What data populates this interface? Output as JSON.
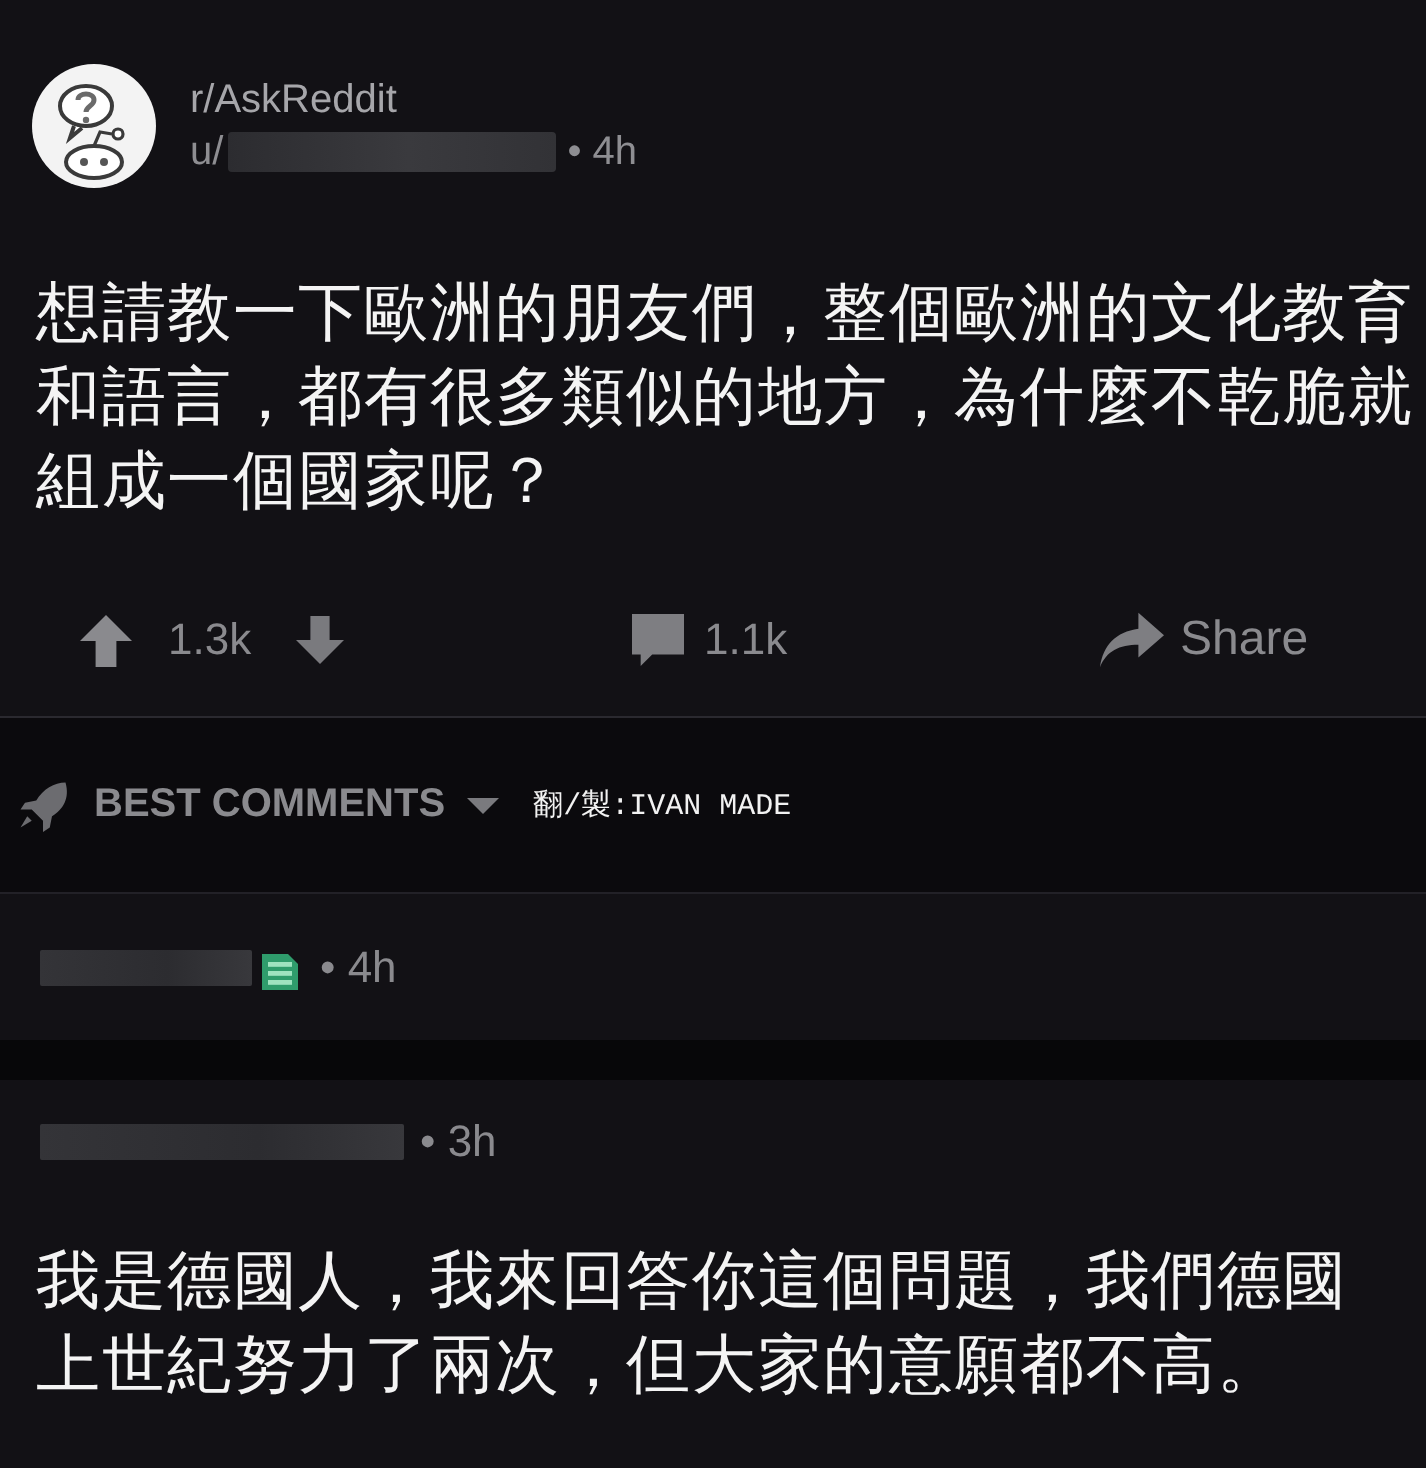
{
  "post": {
    "subreddit": "r/AskReddit",
    "author_prefix": "u/",
    "age": "• 4h",
    "title": "想請教一下歐洲的朋友們，整個歐洲的文化教育和語言，都有很多類似的地方，為什麼不乾脆就組成一個國家呢？",
    "upvotes": "1.3k",
    "comments": "1.1k",
    "share": "Share"
  },
  "sort_bar": {
    "label": "BEST COMMENTS",
    "credit": "翻/製:IVAN MADE"
  },
  "comments": [
    {
      "age": "• 4h",
      "flair": true
    },
    {
      "age": "• 3h",
      "flair": false,
      "body": "我是德國人，我來回答你這個問題，我們德國上世紀努力了兩次，但大家的意願都不高。"
    }
  ]
}
